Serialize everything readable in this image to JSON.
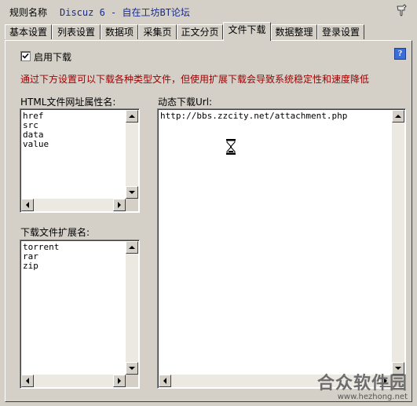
{
  "header": {
    "label": "规则名称",
    "value": "Discuz 6 - 自在工坊BT论坛"
  },
  "tabs": [
    {
      "label": "基本设置"
    },
    {
      "label": "列表设置"
    },
    {
      "label": "数据项"
    },
    {
      "label": "采集页"
    },
    {
      "label": "正文分页"
    },
    {
      "label": "文件下载"
    },
    {
      "label": "数据整理"
    },
    {
      "label": "登录设置"
    }
  ],
  "active_tab": "文件下载",
  "enable_download": {
    "label": "启用下载",
    "checked": true
  },
  "help_label": "?",
  "warning": "通过下方设置可以下载各种类型文件，但使用扩展下载会导致系统稳定性和速度降低",
  "html_attr": {
    "label": "HTML文件网址属性名:",
    "value": "href\nsrc\ndata\nvalue"
  },
  "file_ext": {
    "label": "下载文件扩展名:",
    "value": "torrent\nrar\nzip"
  },
  "dynamic_url": {
    "label": "动态下载Url:",
    "value": "http://bbs.zzcity.net/attachment.php"
  },
  "watermark": {
    "title": "合众软件园",
    "url": "www.hezhong.net"
  },
  "colors": {
    "warning": "#a00000",
    "header_value": "#1a2b8a",
    "window_bg": "#d4d0c8"
  }
}
